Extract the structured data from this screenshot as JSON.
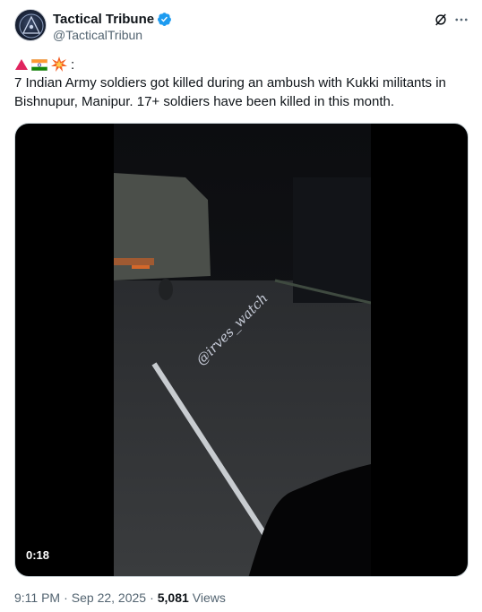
{
  "author": {
    "display_name": "Tactical Tribune",
    "handle": "@TacticalTribun",
    "verified": true,
    "icons": [
      "avatar-logo",
      "verified-badge-icon"
    ]
  },
  "header_actions": {
    "icons": [
      "grok-icon",
      "more-icon"
    ]
  },
  "tweet": {
    "emoji_icons": [
      "red-triangle-icon",
      "india-flag-icon",
      "collision-icon"
    ],
    "emoji_suffix": ":",
    "text": "7 Indian Army soldiers got killed during an ambush with Kukki militants in Bishnupur, Manipur. 17+ soldiers have been killed in this month."
  },
  "media": {
    "watermark": "@irves_watch",
    "duration": "0:18"
  },
  "meta": {
    "time": "9:11 PM",
    "separator": "·",
    "date": "Sep 22, 2025",
    "views_count": "5,081",
    "views_label": "Views"
  },
  "colors": {
    "text_primary": "#0f1419",
    "text_secondary": "#536471",
    "verified_blue": "#1d9bf0"
  }
}
